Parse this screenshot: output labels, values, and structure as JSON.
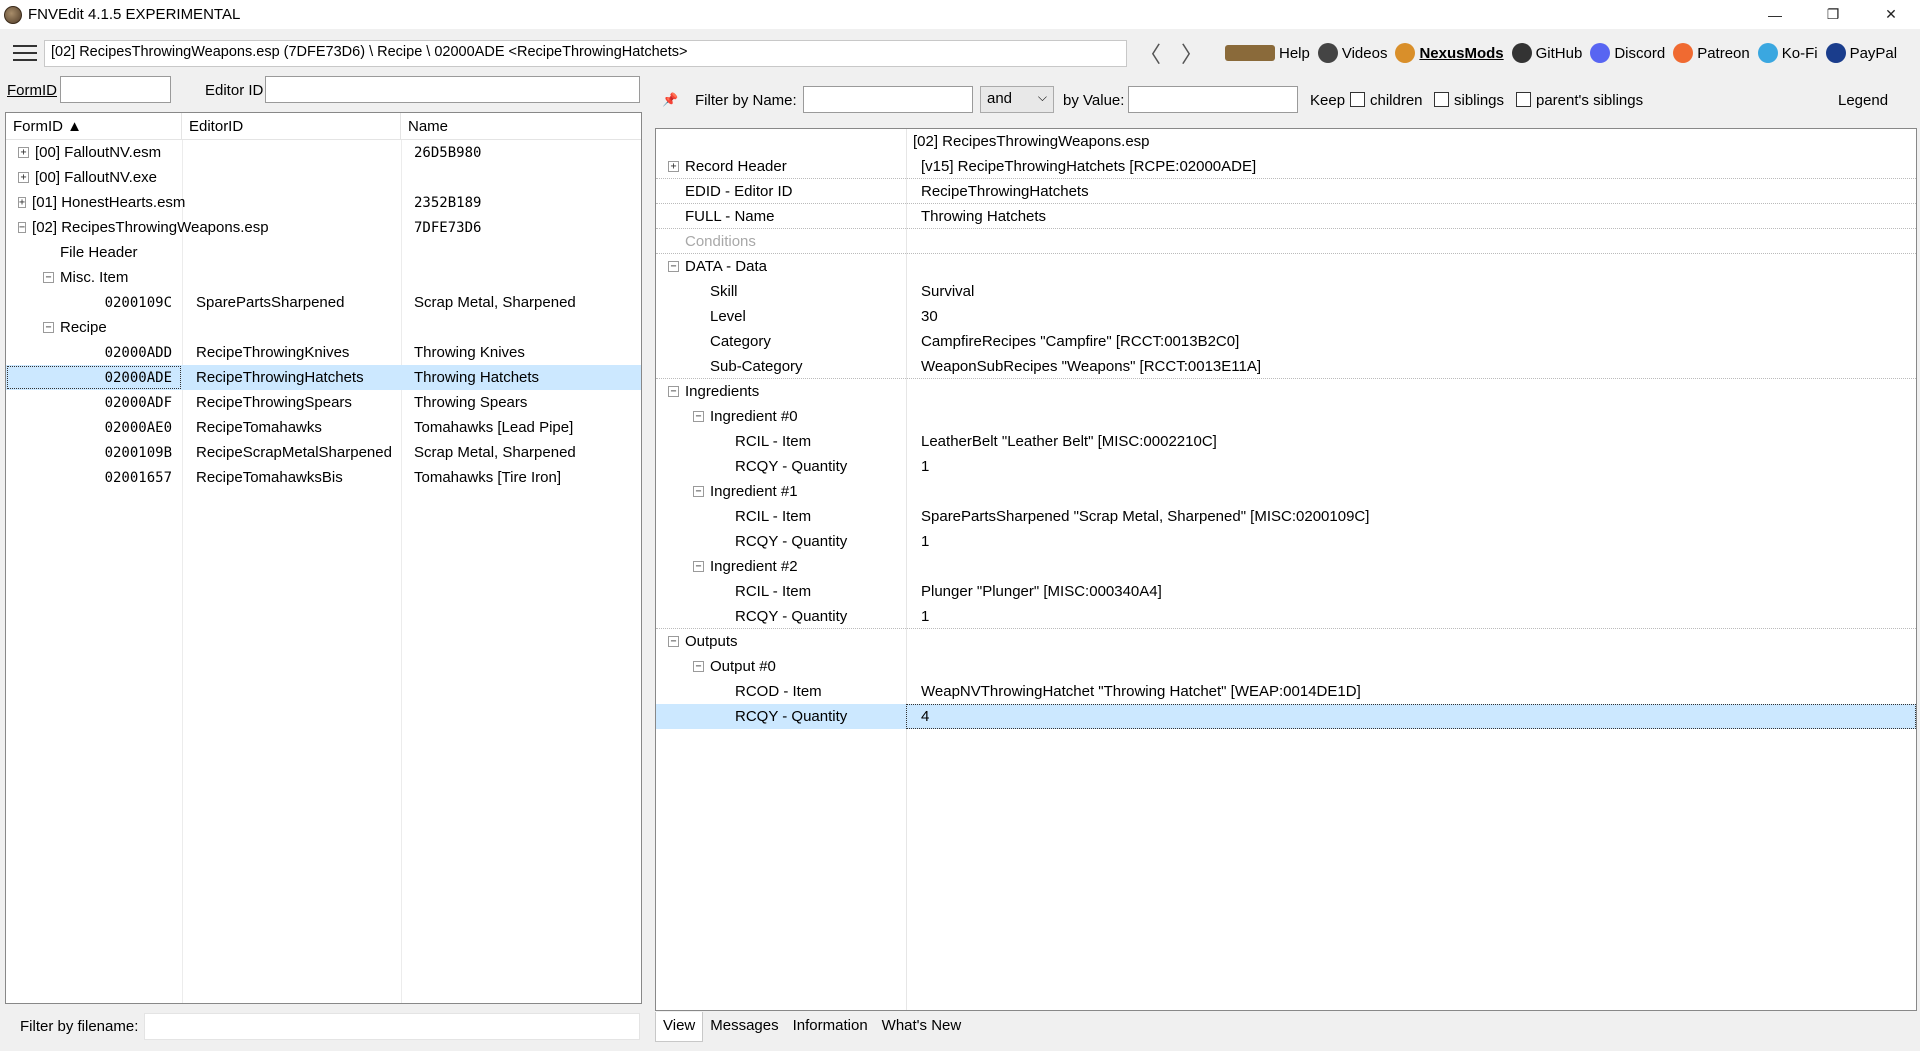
{
  "window": {
    "title": "FNVEdit 4.1.5 EXPERIMENTAL",
    "controls": [
      "—",
      "❐",
      "✕"
    ]
  },
  "toolbar": {
    "path": "[02] RecipesThrowingWeapons.esp (7DFE73D6) \\ Recipe \\ 02000ADE <RecipeThrowingHatchets>",
    "back": "〈",
    "forward": "〉",
    "links": [
      {
        "label": "Help",
        "icon": "book-icon",
        "color": "#8a6a3a"
      },
      {
        "label": "Videos",
        "icon": "video-icon",
        "color": "#444444"
      },
      {
        "label": "NexusMods",
        "icon": "nexus-icon",
        "color": "#d98f2a"
      },
      {
        "label": "GitHub",
        "icon": "github-icon",
        "color": "#333333"
      },
      {
        "label": "Discord",
        "icon": "discord-icon",
        "color": "#5865f2"
      },
      {
        "label": "Patreon",
        "icon": "patreon-icon",
        "color": "#f06a31"
      },
      {
        "label": "Ko-Fi",
        "icon": "kofi-icon",
        "color": "#3aa7e0"
      },
      {
        "label": "PayPal",
        "icon": "paypal-icon",
        "color": "#1a3d8c"
      }
    ]
  },
  "left": {
    "formid_label": "FormID",
    "editorid_label": "Editor ID",
    "columns": [
      "FormID ▲",
      "EditorID",
      "Name"
    ],
    "rows": [
      {
        "indent": 0,
        "exp": "+",
        "id": "[00] FalloutNV.esm",
        "edid": "",
        "name": "26D5B980",
        "mono_name": true
      },
      {
        "indent": 0,
        "exp": "+",
        "id": "[00] FalloutNV.exe",
        "edid": "",
        "name": ""
      },
      {
        "indent": 0,
        "exp": "+",
        "id": "[01] HonestHearts.esm",
        "edid": "",
        "name": "2352B189",
        "mono_name": true
      },
      {
        "indent": 0,
        "exp": "−",
        "id": "[02] RecipesThrowingWeapons.esp",
        "edid": "",
        "name": "7DFE73D6",
        "mono_name": true
      },
      {
        "indent": 1,
        "exp": "",
        "id": "File Header",
        "edid": "",
        "name": ""
      },
      {
        "indent": 1,
        "exp": "−",
        "id": "Misc. Item",
        "edid": "",
        "name": ""
      },
      {
        "indent": 2,
        "exp": "",
        "id": "0200109C",
        "edid": "SparePartsSharpened",
        "name": "Scrap Metal, Sharpened",
        "mono_id": true
      },
      {
        "indent": 1,
        "exp": "−",
        "id": "Recipe",
        "edid": "",
        "name": ""
      },
      {
        "indent": 2,
        "exp": "",
        "id": "02000ADD",
        "edid": "RecipeThrowingKnives",
        "name": "Throwing Knives",
        "mono_id": true
      },
      {
        "indent": 2,
        "exp": "",
        "id": "02000ADE",
        "edid": "RecipeThrowingHatchets",
        "name": "Throwing Hatchets",
        "mono_id": true,
        "selected": true
      },
      {
        "indent": 2,
        "exp": "",
        "id": "02000ADF",
        "edid": "RecipeThrowingSpears",
        "name": "Throwing Spears",
        "mono_id": true
      },
      {
        "indent": 2,
        "exp": "",
        "id": "02000AE0",
        "edid": "RecipeTomahawks",
        "name": "Tomahawks [Lead Pipe]",
        "mono_id": true
      },
      {
        "indent": 2,
        "exp": "",
        "id": "0200109B",
        "edid": "RecipeScrapMetalSharpened",
        "name": "Scrap Metal, Sharpened",
        "mono_id": true
      },
      {
        "indent": 2,
        "exp": "",
        "id": "02001657",
        "edid": "RecipeTomahawksBis",
        "name": "Tomahawks [Tire Iron]",
        "mono_id": true
      }
    ],
    "filter_label": "Filter by filename:"
  },
  "right": {
    "filter_name_label": "Filter by Name:",
    "and_label": "and",
    "by_value_label": "by Value:",
    "keep_label": "Keep",
    "children_label": "children",
    "siblings_label": "siblings",
    "parent_siblings_label": "parent's siblings",
    "legend_label": "Legend",
    "file_header": "[02] RecipesThrowingWeapons.esp",
    "rows": [
      {
        "indent": 0,
        "exp": "+",
        "key": "Record Header",
        "value": "[v15] RecipeThrowingHatchets [RCPE:02000ADE]",
        "sep": true
      },
      {
        "indent": 0,
        "exp": "",
        "key": "EDID - Editor ID",
        "value": "RecipeThrowingHatchets",
        "sep": true
      },
      {
        "indent": 0,
        "exp": "",
        "key": "FULL - Name",
        "value": "Throwing Hatchets",
        "sep": true
      },
      {
        "indent": 0,
        "exp": "",
        "key": "Conditions",
        "value": "",
        "grey": true,
        "sep": true
      },
      {
        "indent": 0,
        "exp": "−",
        "key": "DATA - Data",
        "value": ""
      },
      {
        "indent": 1,
        "exp": "",
        "key": "Skill",
        "value": "Survival"
      },
      {
        "indent": 1,
        "exp": "",
        "key": "Level",
        "value": "30"
      },
      {
        "indent": 1,
        "exp": "",
        "key": "Category",
        "value": "CampfireRecipes \"Campfire\" [RCCT:0013B2C0]"
      },
      {
        "indent": 1,
        "exp": "",
        "key": "Sub-Category",
        "value": "WeaponSubRecipes \"Weapons\" [RCCT:0013E11A]",
        "sep": true
      },
      {
        "indent": 0,
        "exp": "−",
        "key": "Ingredients",
        "value": ""
      },
      {
        "indent": 1,
        "exp": "−",
        "key": "Ingredient #0",
        "value": ""
      },
      {
        "indent": 2,
        "exp": "",
        "key": "RCIL - Item",
        "value": "LeatherBelt \"Leather Belt\" [MISC:0002210C]"
      },
      {
        "indent": 2,
        "exp": "",
        "key": "RCQY - Quantity",
        "value": "1"
      },
      {
        "indent": 1,
        "exp": "−",
        "key": "Ingredient #1",
        "value": ""
      },
      {
        "indent": 2,
        "exp": "",
        "key": "RCIL - Item",
        "value": "SparePartsSharpened \"Scrap Metal, Sharpened\" [MISC:0200109C]"
      },
      {
        "indent": 2,
        "exp": "",
        "key": "RCQY - Quantity",
        "value": "1"
      },
      {
        "indent": 1,
        "exp": "−",
        "key": "Ingredient #2",
        "value": ""
      },
      {
        "indent": 2,
        "exp": "",
        "key": "RCIL - Item",
        "value": "Plunger \"Plunger\" [MISC:000340A4]"
      },
      {
        "indent": 2,
        "exp": "",
        "key": "RCQY - Quantity",
        "value": "1",
        "sep": true
      },
      {
        "indent": 0,
        "exp": "−",
        "key": "Outputs",
        "value": ""
      },
      {
        "indent": 1,
        "exp": "−",
        "key": "Output #0",
        "value": ""
      },
      {
        "indent": 2,
        "exp": "",
        "key": "RCOD - Item",
        "value": "WeapNVThrowingHatchet \"Throwing Hatchet\" [WEAP:0014DE1D]"
      },
      {
        "indent": 2,
        "exp": "",
        "key": "RCQY - Quantity",
        "value": "4",
        "selected": true
      }
    ],
    "tabs": [
      "View",
      "Messages",
      "Information",
      "What's New"
    ]
  }
}
